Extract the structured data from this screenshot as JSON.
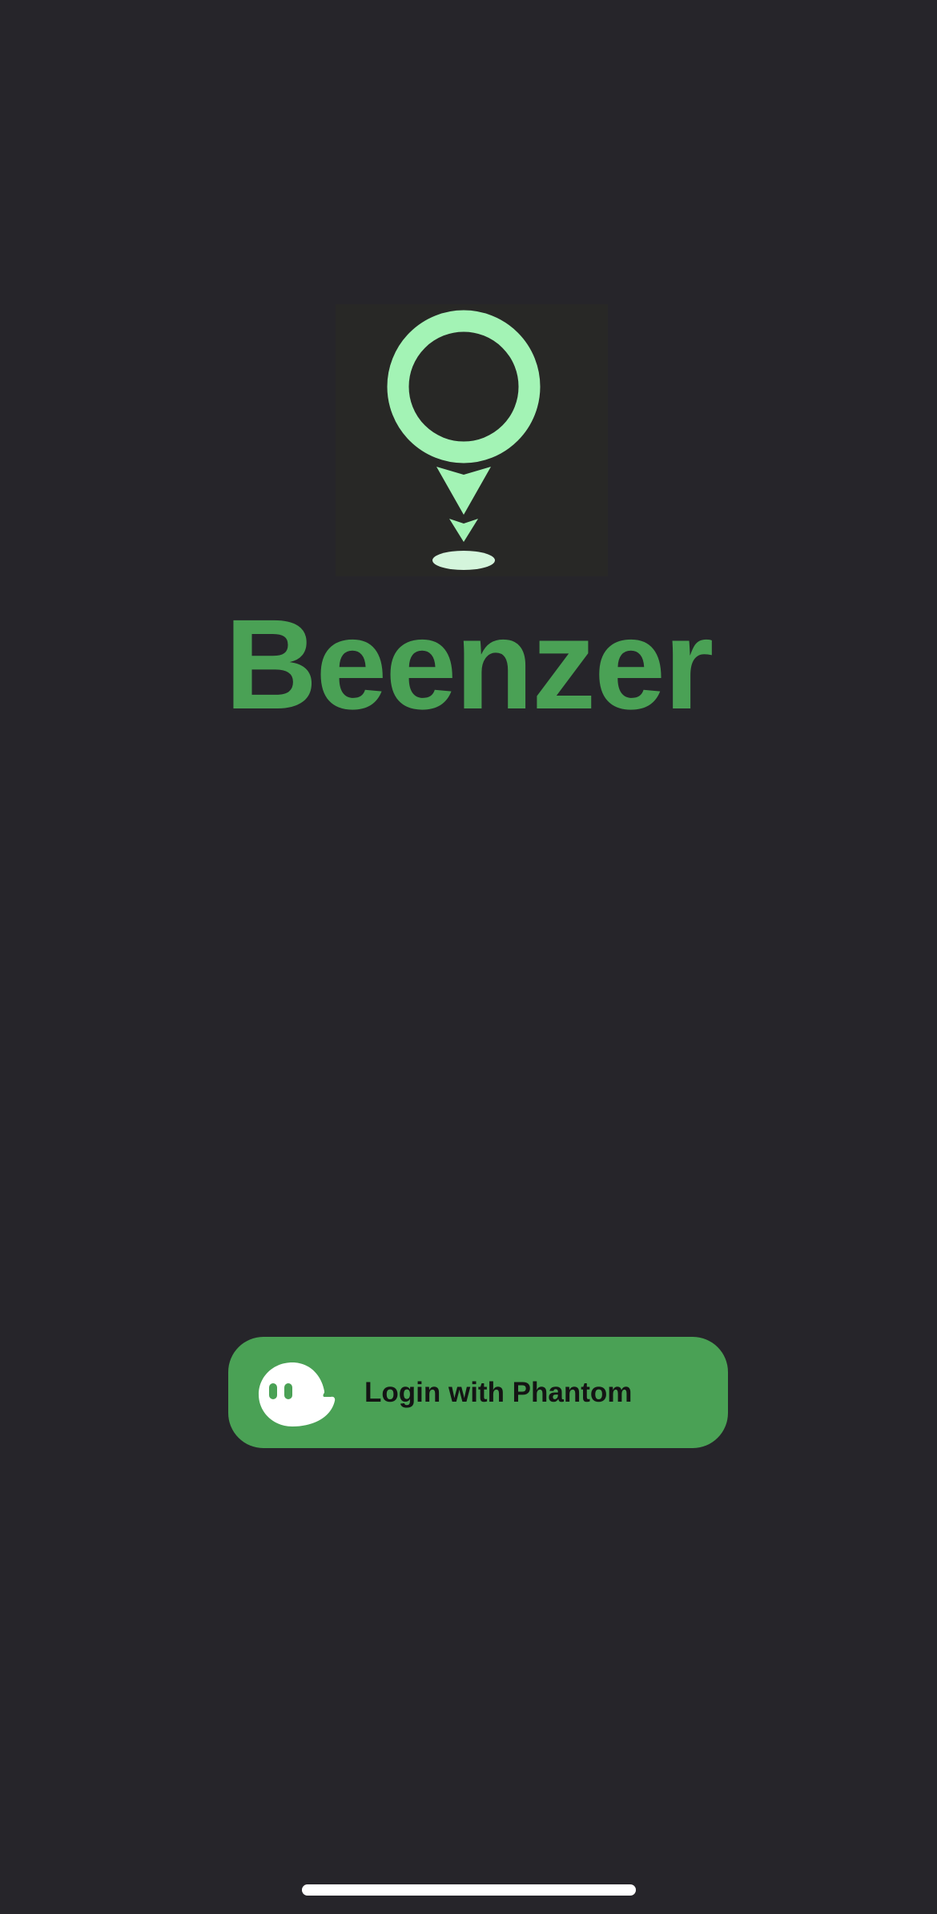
{
  "app": {
    "name": "Beenzer"
  },
  "logo": {
    "icon": "location-pin-icon",
    "ring_color": "#a3f3b5",
    "background_color": "#282826"
  },
  "login": {
    "label": "Login with Phantom",
    "icon": "phantom-ghost-icon",
    "button_color": "#4aa155",
    "text_color": "#141414"
  },
  "colors": {
    "background": "#26252a",
    "brand_green": "#4aa155",
    "accent_light_green": "#a3f3b5"
  }
}
